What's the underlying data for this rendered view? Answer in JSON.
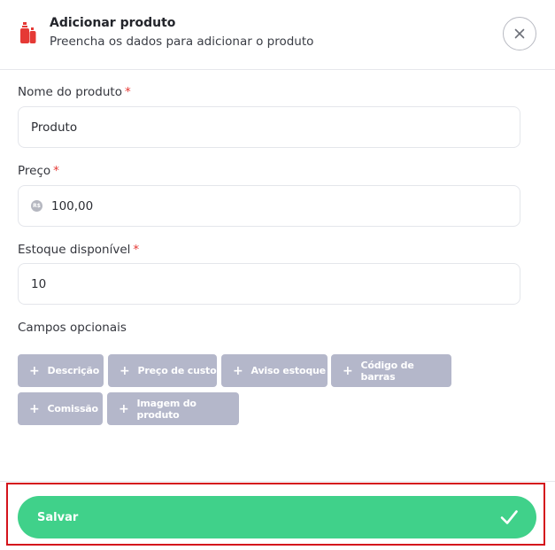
{
  "header": {
    "title": "Adicionar produto",
    "subtitle": "Preencha os dados para adicionar o produto",
    "icon": "product-bottles-icon",
    "close_icon": "close-icon"
  },
  "form": {
    "name": {
      "label": "Nome do produto",
      "required_mark": "*",
      "value": "Produto"
    },
    "price": {
      "label": "Preço",
      "required_mark": "*",
      "currency_symbol": "R$",
      "value": "100,00"
    },
    "stock": {
      "label": "Estoque disponível",
      "required_mark": "*",
      "value": "10"
    }
  },
  "optional": {
    "title": "Campos opcionais",
    "chips": [
      {
        "label": "Descrição"
      },
      {
        "label": "Preço de custo"
      },
      {
        "label": "Aviso estoque"
      },
      {
        "label": "Código de barras"
      },
      {
        "label": "Comissão"
      },
      {
        "label": "Imagem do produto"
      }
    ],
    "plus_glyph": "+"
  },
  "footer": {
    "save_label": "Salvar",
    "save_icon": "check-icon"
  },
  "colors": {
    "accent_green": "#40d18a",
    "chip_bg": "#b4b7ca",
    "required_red": "#e53935",
    "highlight_red": "#d4141c",
    "icon_red": "#e53935"
  }
}
